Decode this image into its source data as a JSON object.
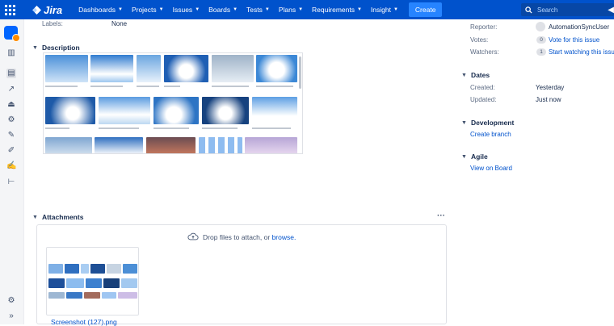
{
  "nav": {
    "app": "Jira",
    "menu": [
      "Dashboards",
      "Projects",
      "Issues",
      "Boards",
      "Tests",
      "Plans",
      "Requirements",
      "Insight"
    ],
    "create": "Create",
    "search_placeholder": "Search"
  },
  "rail": {
    "icons": [
      "project-avatar-icon",
      "board-icon",
      "backlog-icon",
      "reports-icon",
      "releases-icon",
      "settings-icon",
      "test-icon",
      "test-plan-icon",
      "test-run-icon",
      "hierarchy-icon",
      "settings-bottom-icon",
      "expand-icon"
    ]
  },
  "fields": {
    "labels_label": "Labels:",
    "labels_value": "None"
  },
  "description": {
    "title": "Description"
  },
  "attachments": {
    "title": "Attachments",
    "more": "···",
    "drop_text": "Drop files to attach, or",
    "browse": "browse.",
    "file_name": "Screenshot (127).png"
  },
  "people": {
    "reporter_label": "Reporter:",
    "reporter_value": "AutomationSyncUser",
    "votes_label": "Votes:",
    "votes_count": "0",
    "votes_link": "Vote for this issue",
    "watchers_label": "Watchers:",
    "watchers_count": "1",
    "watchers_link": "Start watching this issue"
  },
  "dates": {
    "title": "Dates",
    "created_label": "Created:",
    "created_value": "Yesterday",
    "updated_label": "Updated:",
    "updated_value": "Just now"
  },
  "development": {
    "title": "Development",
    "link": "Create branch"
  },
  "agile": {
    "title": "Agile",
    "link": "View on Board"
  },
  "colors": {
    "brand": "#0052cc",
    "create": "#2684ff",
    "sky": "#4a90d9"
  }
}
